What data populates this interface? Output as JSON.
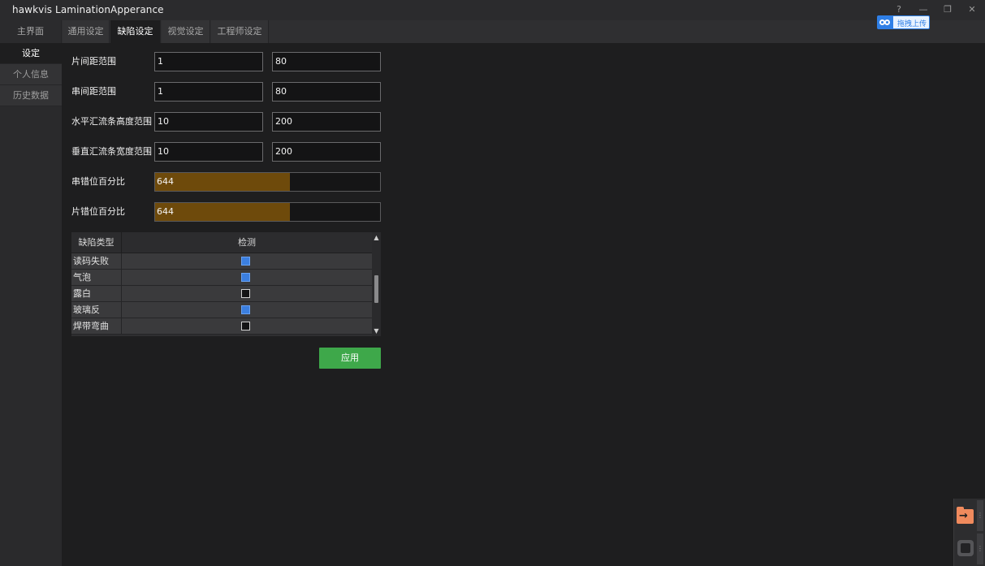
{
  "titlebar": {
    "app_name": "hawkvis",
    "window_title": "LaminationApperance",
    "help": "?",
    "minimize": "—",
    "restore": "❐",
    "close": "✕"
  },
  "upload_chip": {
    "label": "拖拽上传"
  },
  "tabs": [
    {
      "label": "主界面"
    },
    {
      "label": "通用设定"
    },
    {
      "label": "缺陷设定"
    },
    {
      "label": "视觉设定"
    },
    {
      "label": "工程师设定"
    }
  ],
  "sidebar": {
    "items": [
      {
        "label": "设定"
      },
      {
        "label": "个人信息"
      },
      {
        "label": "历史数据"
      }
    ]
  },
  "form": {
    "rows": [
      {
        "label": "片间距范围",
        "min": "1",
        "max": "80"
      },
      {
        "label": "串间距范围",
        "min": "1",
        "max": "80"
      },
      {
        "label": "水平汇流条高度范围",
        "min": "10",
        "max": "200"
      },
      {
        "label": "垂直汇流条宽度范围",
        "min": "10",
        "max": "200"
      }
    ],
    "sliders": [
      {
        "label": "串错位百分比",
        "value": "644",
        "fill_fraction": 0.6
      },
      {
        "label": "片错位百分比",
        "value": "644",
        "fill_fraction": 0.6
      }
    ]
  },
  "defect_table": {
    "headers": [
      "缺陷类型",
      "检测"
    ],
    "rows": [
      {
        "type": "读码失败",
        "checked": true
      },
      {
        "type": "气泡",
        "checked": true
      },
      {
        "type": "露白",
        "checked": false
      },
      {
        "type": "玻璃反",
        "checked": true
      },
      {
        "type": "焊带弯曲",
        "checked": false
      }
    ],
    "scroll_up": "▲",
    "scroll_down": "▼"
  },
  "apply_button": {
    "label": "应用"
  },
  "float_panel": {
    "grip": "⋮"
  },
  "colors": {
    "accent_green": "#3ea84a",
    "checkbox_blue": "#3b7fe0",
    "slider_fill": "#6e4a0b",
    "folder_orange": "#f08a5d"
  }
}
